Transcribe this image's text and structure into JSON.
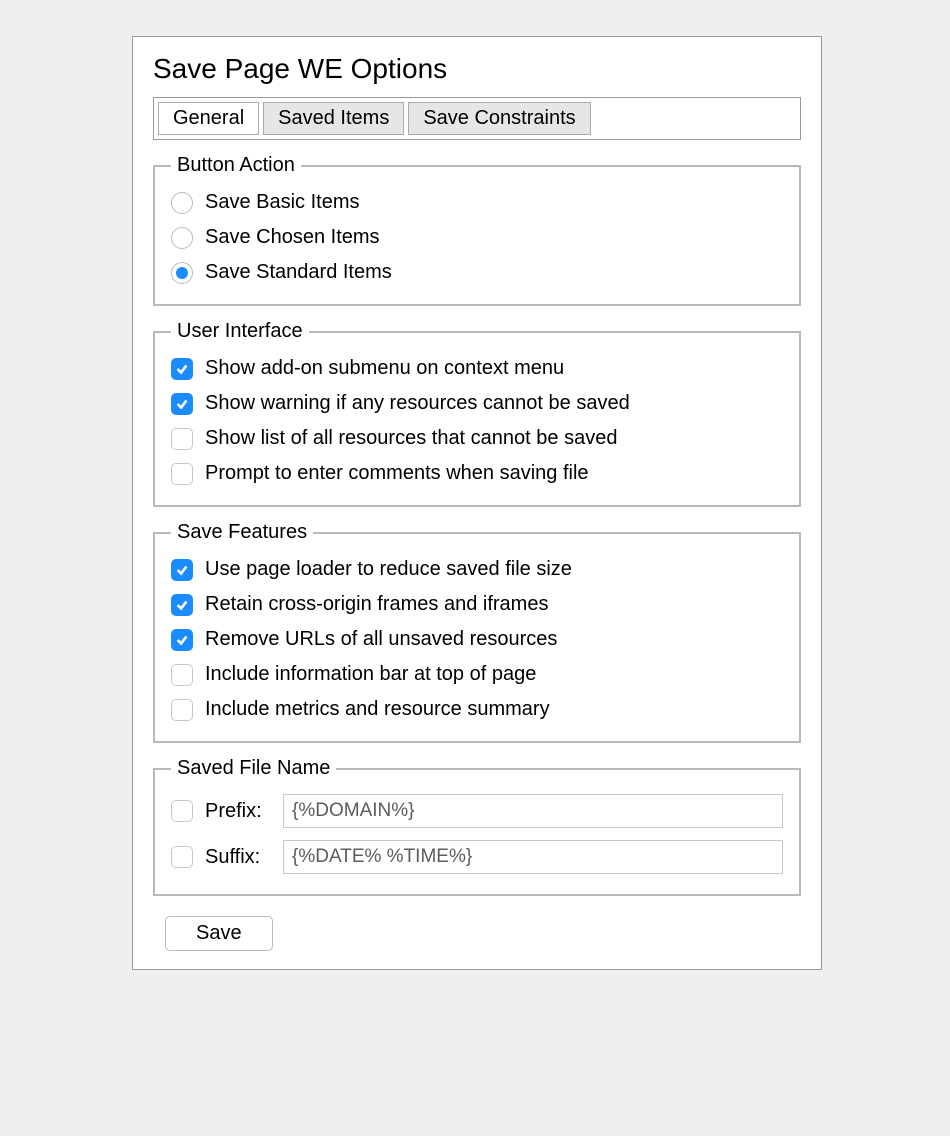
{
  "title": "Save Page WE Options",
  "tabs": [
    {
      "label": "General",
      "active": true
    },
    {
      "label": "Saved Items",
      "active": false
    },
    {
      "label": "Save Constraints",
      "active": false
    }
  ],
  "buttonAction": {
    "legend": "Button Action",
    "options": [
      {
        "label": "Save Basic Items",
        "selected": false
      },
      {
        "label": "Save Chosen Items",
        "selected": false
      },
      {
        "label": "Save Standard Items",
        "selected": true
      }
    ]
  },
  "userInterface": {
    "legend": "User Interface",
    "options": [
      {
        "label": "Show add-on submenu on context menu",
        "checked": true
      },
      {
        "label": "Show warning if any resources cannot be saved",
        "checked": true
      },
      {
        "label": "Show list of all resources that cannot be saved",
        "checked": false
      },
      {
        "label": "Prompt to enter comments when saving file",
        "checked": false
      }
    ]
  },
  "saveFeatures": {
    "legend": "Save Features",
    "options": [
      {
        "label": "Use page loader to reduce saved file size",
        "checked": true
      },
      {
        "label": "Retain cross-origin frames and iframes",
        "checked": true
      },
      {
        "label": "Remove URLs of all unsaved resources",
        "checked": true
      },
      {
        "label": "Include information bar at top of page",
        "checked": false
      },
      {
        "label": "Include metrics and resource summary",
        "checked": false
      }
    ]
  },
  "savedFileName": {
    "legend": "Saved File Name",
    "prefix": {
      "label": "Prefix:",
      "checked": false,
      "value": "{%DOMAIN%}"
    },
    "suffix": {
      "label": "Suffix:",
      "checked": false,
      "value": "{%DATE% %TIME%}"
    }
  },
  "saveButton": "Save"
}
